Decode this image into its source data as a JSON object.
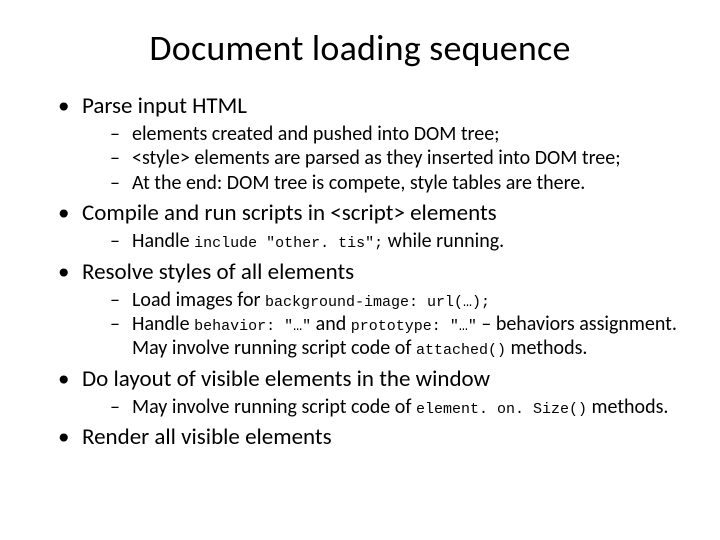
{
  "title": "Document loading sequence",
  "bullets": [
    {
      "text": "Parse input HTML",
      "sub": [
        {
          "parts": [
            {
              "t": "elements created and pushed into DOM tree;"
            }
          ]
        },
        {
          "parts": [
            {
              "t": "<style> elements are parsed as they inserted into DOM tree;"
            }
          ]
        },
        {
          "parts": [
            {
              "t": "At the end: DOM tree is compete, style tables are there."
            }
          ]
        }
      ]
    },
    {
      "text": "Compile and run scripts in <script> elements",
      "sub": [
        {
          "parts": [
            {
              "t": "Handle "
            },
            {
              "t": "include \"other. tis\";",
              "code": true
            },
            {
              "t": " while running."
            }
          ]
        }
      ]
    },
    {
      "text": "Resolve styles of all elements",
      "sub": [
        {
          "parts": [
            {
              "t": "Load images for "
            },
            {
              "t": "background-image: url(…);",
              "code": true
            }
          ]
        },
        {
          "parts": [
            {
              "t": "Handle "
            },
            {
              "t": "behavior: \"…\"",
              "code": true
            },
            {
              "t": " and "
            },
            {
              "t": "prototype: \"…\"",
              "code": true
            },
            {
              "t": " – behaviors assignment. May involve running script code of "
            },
            {
              "t": "attached()",
              "code": true
            },
            {
              "t": " methods."
            }
          ]
        }
      ]
    },
    {
      "text": "Do layout of visible elements in the window",
      "sub": [
        {
          "parts": [
            {
              "t": "May involve running script code of "
            },
            {
              "t": "element. on. Size()",
              "code": true
            },
            {
              "t": " methods."
            }
          ]
        }
      ]
    },
    {
      "text": "Render all visible elements",
      "sub": []
    }
  ]
}
